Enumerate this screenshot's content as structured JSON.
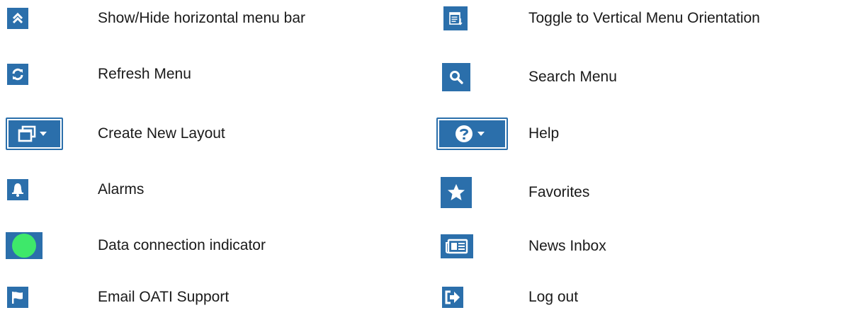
{
  "colors": {
    "tile_blue": "#2b6fab",
    "indicator_green": "#3ee86a",
    "text": "#1a1a1a"
  },
  "legend": {
    "left": [
      {
        "icon": "double-chevron-up-icon",
        "label": "Show/Hide horizontal menu bar"
      },
      {
        "icon": "refresh-icon",
        "label": "Refresh Menu"
      },
      {
        "icon": "new-layout-window-dropdown-icon",
        "label": "Create New Layout"
      },
      {
        "icon": "bell-icon",
        "label": "Alarms"
      },
      {
        "icon": "green-dot-icon",
        "label": "Data connection indicator"
      },
      {
        "icon": "flag-icon",
        "label": "Email OATI Support"
      }
    ],
    "right": [
      {
        "icon": "vertical-menu-toggle-icon",
        "label": "Toggle to Vertical Menu Orientation"
      },
      {
        "icon": "search-icon",
        "label": "Search Menu"
      },
      {
        "icon": "help-question-dropdown-icon",
        "label": "Help"
      },
      {
        "icon": "star-icon",
        "label": "Favorites"
      },
      {
        "icon": "newspaper-icon",
        "label": "News Inbox"
      },
      {
        "icon": "sign-out-arrow-icon",
        "label": "Log out"
      }
    ]
  }
}
